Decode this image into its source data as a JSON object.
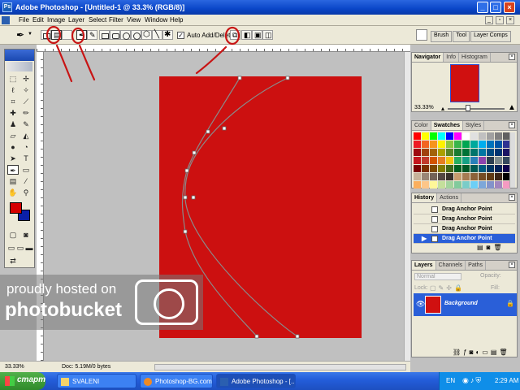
{
  "window": {
    "app_icon": "Ps",
    "title": "Adobe Photoshop - [Untitled-1 @ 33.3% (RGB/8)]",
    "controls": [
      "minimize-icon",
      "maximize-icon",
      "close-icon"
    ]
  },
  "menubar": {
    "items": [
      "File",
      "Edit",
      "Image",
      "Layer",
      "Select",
      "Filter",
      "View",
      "Window",
      "Help"
    ]
  },
  "options_bar": {
    "auto_add_delete_label": "Auto Add/Delete",
    "auto_add_delete_checked": true,
    "palette_well_tabs": [
      "Brush",
      "Tool",
      "Layer Comps"
    ]
  },
  "toolbox": {
    "foreground_color": "#d50000",
    "background_color": "#0a1fa8"
  },
  "navigator": {
    "tabs": [
      "Navigator",
      "Info",
      "Histogram"
    ],
    "zoom": "33.33%"
  },
  "swatches": {
    "tabs": [
      "Color",
      "Swatches",
      "Styles"
    ]
  },
  "history": {
    "tabs": [
      "History",
      "Actions"
    ],
    "items": [
      "Drag Anchor Point",
      "Drag Anchor Point",
      "Drag Anchor Point",
      "Drag Anchor Point"
    ],
    "active_index": 3
  },
  "layers": {
    "tabs": [
      "Layers",
      "Channels",
      "Paths"
    ],
    "blend_mode": "Normal",
    "opacity_label": "Opacity:",
    "lock_label": "Lock:",
    "fill_label": "Fill:",
    "layer_name": "Background"
  },
  "status": {
    "zoom": "33.33%",
    "doc_size": "Doc: 5.19M/0 bytes"
  },
  "document": {
    "fill_color": "#cc1010"
  },
  "watermark": {
    "line1": "proudly hosted on",
    "line2": "photobucket"
  },
  "taskbar": {
    "start_label": "старт",
    "tasks": [
      "SVALENI",
      "Photoshop-BG.com - ...",
      "Adobe Photoshop - [..."
    ],
    "active_task_index": 2,
    "language": "EN",
    "time": "2:29 AM"
  }
}
